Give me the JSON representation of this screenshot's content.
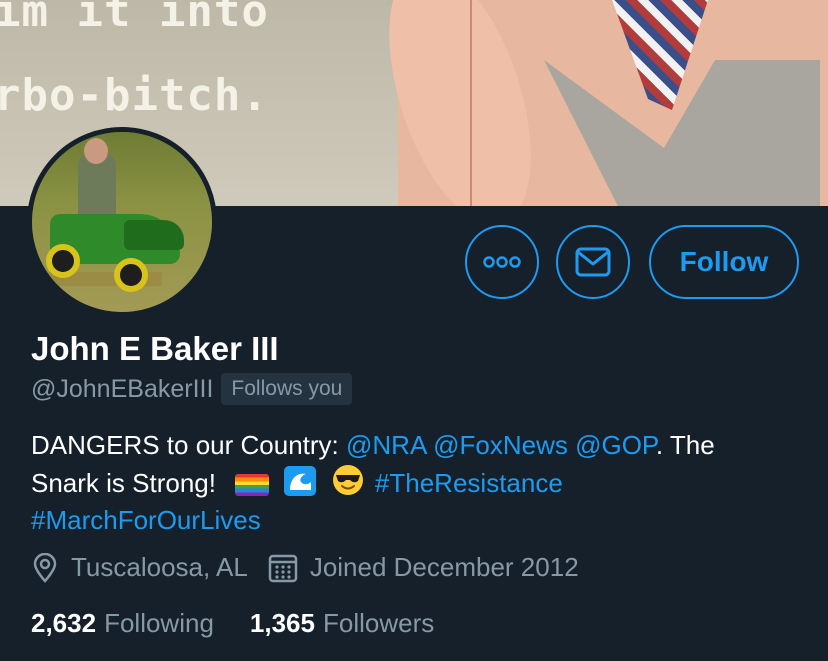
{
  "banner": {
    "caption_line1": "im it into",
    "caption_line2": "rbo-bitch."
  },
  "profile": {
    "display_name": "John E Baker III",
    "handle": "@JohnEBakerIII",
    "follows_you_badge": "Follows you",
    "bio": {
      "line1_text": "DANGERS to our Country: ",
      "mention_nra": "@NRA",
      "mention_foxnews": "@FoxNews",
      "mention_gop": "@GOP",
      "line1_end": ". The",
      "line2_text": "Snark is Strong!",
      "hashtag_resistance": "#TheResistance",
      "hashtag_march": "#MarchForOurLives"
    },
    "location": "Tuscaloosa, AL",
    "joined": "Joined December 2012",
    "following_count": "2,632",
    "following_label": "Following",
    "followers_count": "1,365",
    "followers_label": "Followers"
  },
  "actions": {
    "more_icon": "more-dots-icon",
    "message_icon": "envelope-icon",
    "follow_label": "Follow"
  },
  "colors": {
    "background": "#15202b",
    "accent": "#1d9bf0",
    "secondary_text": "#8899a6",
    "badge_bg": "#253341"
  }
}
